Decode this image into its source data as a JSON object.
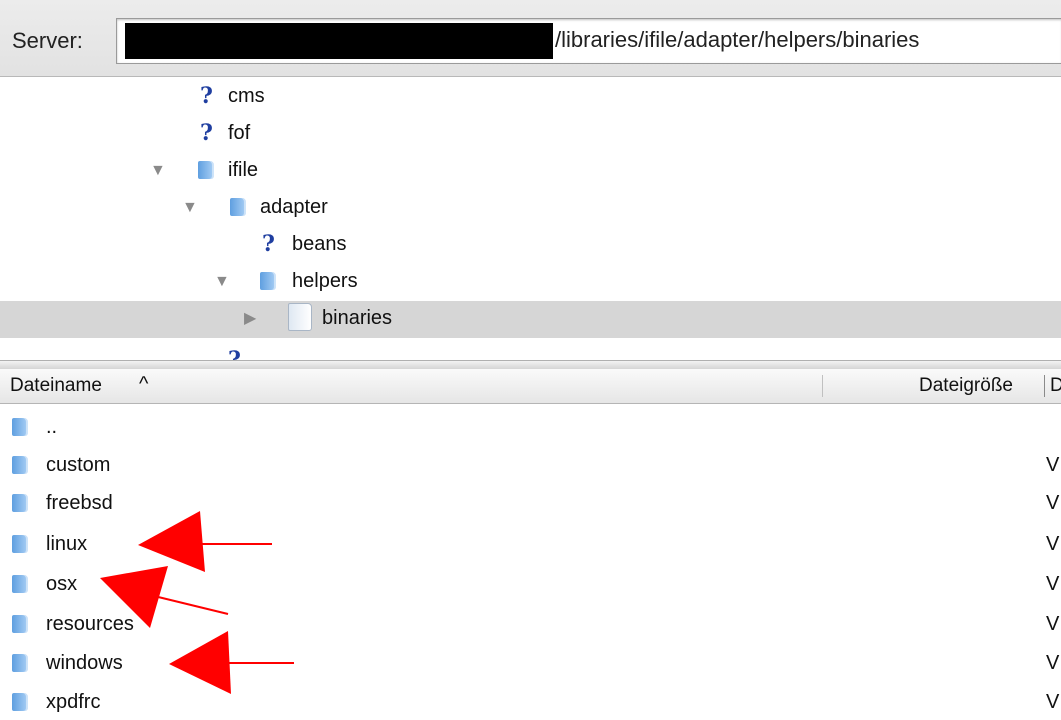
{
  "server_bar": {
    "label": "Server:",
    "path": "/libraries/ifile/adapter/helpers/binaries"
  },
  "tree": {
    "items": [
      {
        "label": "cms",
        "icon": "question-icon",
        "expanded": null
      },
      {
        "label": "fof",
        "icon": "question-icon",
        "expanded": null
      },
      {
        "label": "ifile",
        "icon": "folder-icon",
        "expanded": true
      },
      {
        "label": "adapter",
        "icon": "folder-icon",
        "expanded": true
      },
      {
        "label": "beans",
        "icon": "question-icon",
        "expanded": null
      },
      {
        "label": "helpers",
        "icon": "folder-icon",
        "expanded": true
      },
      {
        "label": "binaries",
        "icon": "folder-icon",
        "expanded": false,
        "selected": true
      }
    ]
  },
  "file_list": {
    "columns": {
      "name": "Dateiname",
      "size": "Dateigröße",
      "next": "D"
    },
    "sort_icon": "chevron-up-icon",
    "rows": [
      {
        "name": "..",
        "type": ""
      },
      {
        "name": "custom",
        "type": "V"
      },
      {
        "name": "freebsd",
        "type": "V"
      },
      {
        "name": "linux",
        "type": "V"
      },
      {
        "name": "osx",
        "type": "V"
      },
      {
        "name": "resources",
        "type": "V"
      },
      {
        "name": "windows",
        "type": "V"
      },
      {
        "name": "xpdfrc",
        "type": "V"
      }
    ]
  },
  "colors": {
    "annotation_arrow": "#ff0000",
    "folder_blue": "#6aa6e6",
    "selected_row": "#d6d6d6"
  }
}
